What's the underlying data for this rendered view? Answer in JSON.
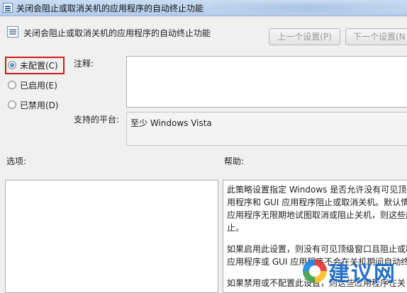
{
  "window": {
    "title": "关闭会阻止或取消关机的应用程序的自动终止功能"
  },
  "header": {
    "title": "关闭会阻止或取消关机的应用程序的自动终止功能",
    "prev_button": "上一个设置(P)",
    "next_button": "下一个设置(N"
  },
  "state": {
    "options": [
      {
        "label": "未配置(C)",
        "selected": true
      },
      {
        "label": "已启用(E)",
        "selected": false
      },
      {
        "label": "已禁用(D)",
        "selected": false
      }
    ]
  },
  "comment": {
    "label": "注释:",
    "value": ""
  },
  "platform": {
    "label": "支持的平台:",
    "value": "至少 Windows Vista"
  },
  "options_section": {
    "label": "选项:"
  },
  "help_section": {
    "label": "帮助:",
    "paragraphs": [
      [
        "此策略设置指定 Windows 是否允许没有可见顶",
        "用程序和 GUI 应用程序阻止或取消关机。默认情",
        "应用程序无限期地试图取消或阻止关机，则这些应",
        "止。"
      ],
      [
        "如果启用此设置，则没有可见顶级窗口且阻止或取",
        "应用程序或 GUI 应用程序不会在关机期间自动终"
      ],
      [
        "如果禁用或不配置此设置，则这些应用程序在关"
      ]
    ]
  },
  "watermark": {
    "text": "建议网"
  }
}
